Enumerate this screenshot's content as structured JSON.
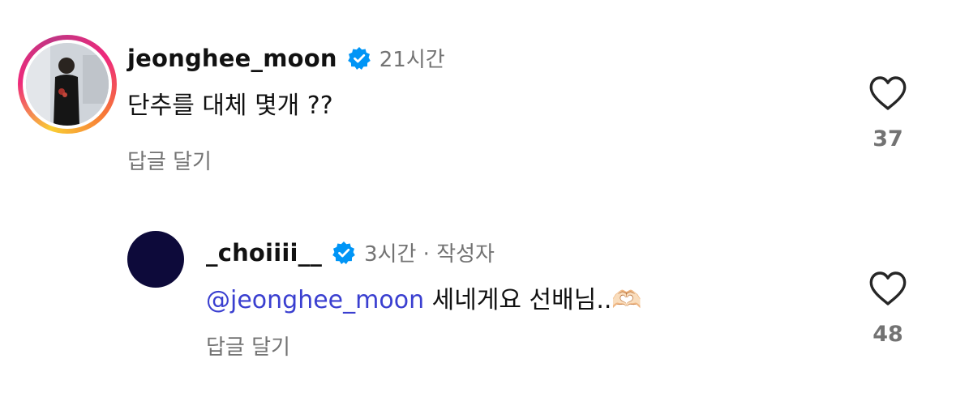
{
  "comments": [
    {
      "username": "jeonghee_moon",
      "verified": true,
      "time": "21시간",
      "text": "단추를 대체 몇개 ??",
      "reply_label": "답글 달기",
      "likes": "37"
    }
  ],
  "replies": [
    {
      "username": "_choiiii__",
      "verified": true,
      "time": "3시간 · 작성자",
      "mention": "@jeonghee_moon",
      "text": "세네게요 선배님..🫶🏻",
      "reply_label": "답글 달기",
      "likes": "48"
    }
  ],
  "colors": {
    "verified_badge": "#0095f6",
    "mention": "#3a3fd0",
    "secondary_text": "#737373",
    "reply_avatar": "#0d0a3a"
  }
}
